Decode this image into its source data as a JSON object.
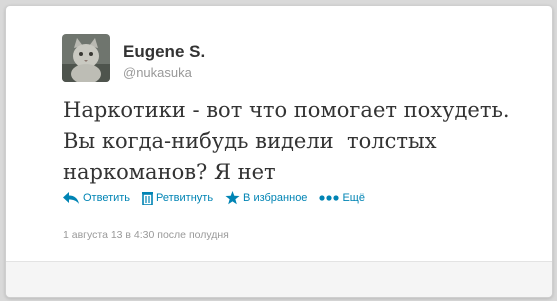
{
  "user": {
    "name": "Eugene S.",
    "handle": "@nukasuka"
  },
  "tweet": {
    "text": "Наркотики - вот что помогает похудеть.\nВы когда-нибудь видели  толстых\nнаркоманов? Я нет",
    "timestamp": "1 августа 13 в 4:30 после полудня"
  },
  "actions": {
    "reply": "Ответить",
    "retweet": "Ретвитнуть",
    "favorite": "В избранное",
    "more": "Ещё"
  },
  "colors": {
    "link": "#0084b4",
    "text": "#333333",
    "muted": "#999999"
  }
}
